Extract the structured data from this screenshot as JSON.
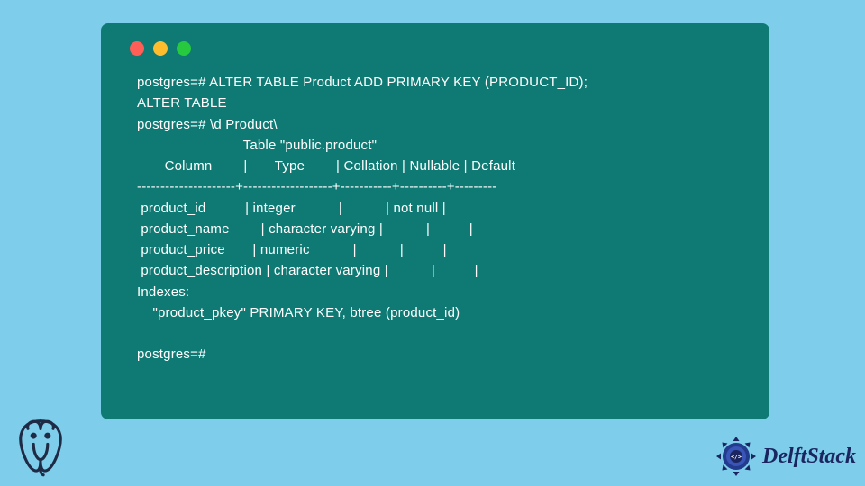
{
  "terminal": {
    "lines": [
      "postgres=# ALTER TABLE Product ADD PRIMARY KEY (PRODUCT_ID);",
      "ALTER TABLE",
      "postgres=# \\d Product\\",
      "                           Table \"public.product\"",
      "       Column        |       Type        | Collation | Nullable | Default",
      "---------------------+-------------------+-----------+----------+---------",
      " product_id          | integer           |           | not null |",
      " product_name        | character varying |           |          |",
      " product_price       | numeric           |           |          |",
      " product_description | character varying |           |          |",
      "Indexes:",
      "    \"product_pkey\" PRIMARY KEY, btree (product_id)",
      "",
      "postgres=#"
    ]
  },
  "branding": {
    "delft_text": "DelftStack"
  },
  "colors": {
    "page_bg": "#7ecdeb",
    "terminal_bg": "#0f7a74",
    "text": "#ffffff",
    "dot_red": "#ff5f56",
    "dot_yellow": "#ffbd2e",
    "dot_green": "#27c93f",
    "delft_blue": "#1b2660"
  }
}
